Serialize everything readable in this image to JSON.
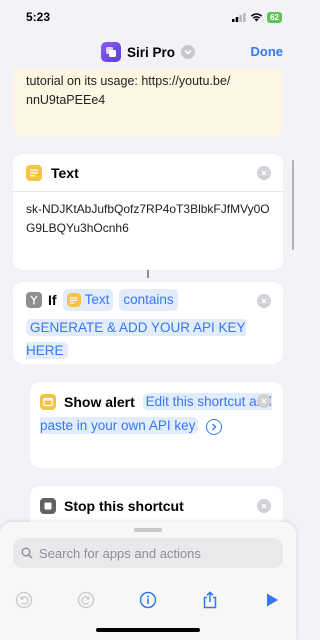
{
  "status_bar": {
    "time": "5:23",
    "battery": "62"
  },
  "nav": {
    "title": "Siri Pro",
    "done_label": "Done"
  },
  "comment": {
    "line1": "tutorial on its usage: https://youtu.be/",
    "line2": "nnU9taPEEe4"
  },
  "text_action": {
    "label": "Text",
    "value": "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"
  },
  "if_action": {
    "label": "If",
    "input_label": "Text",
    "condition": "contains",
    "value": "GENERATE & ADD YOUR API KEY HERE"
  },
  "alert_action": {
    "label": "Show alert",
    "message": "Edit this shortcut and paste in your own API key"
  },
  "stop_action": {
    "label": "Stop this shortcut"
  },
  "search": {
    "placeholder": "Search for apps and actions"
  },
  "icons": {
    "app": "shortcuts-app-icon",
    "text": "text-lines-icon",
    "if": "branch-icon",
    "alert": "alert-window-icon",
    "stop": "stop-square-icon",
    "undo": "undo-icon",
    "redo": "redo-icon",
    "info": "info-icon",
    "share": "share-icon",
    "run": "play-icon"
  },
  "colors": {
    "accent": "#3478f6",
    "text_icon": "#f6c443",
    "comment_bg": "#fdf6e3"
  }
}
